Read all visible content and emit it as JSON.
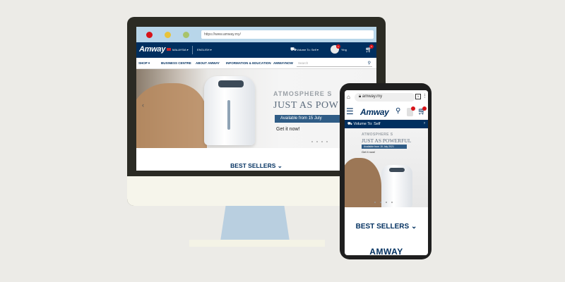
{
  "desktop": {
    "address_url": "https://www.amway.my/",
    "header": {
      "logo": "Amway",
      "country": "MALAYSIA ▾",
      "language": "ENGLISH ▾",
      "volume": "Volume To: Self ▾",
      "user": "Ying",
      "cart_badge": "0",
      "avatar_badge": "1"
    },
    "nav": {
      "items": [
        "SHOP ▾",
        "BUSINESS CENTRE",
        "ABOUT AMWAY",
        "INFORMATION & EDUCATION",
        "AMWAYNOW"
      ],
      "search_placeholder": "Search"
    },
    "hero": {
      "title": "ATMOSPHERE S",
      "subtitle": "JUST AS POW",
      "available": "Available from 15 July",
      "cta": "Get it now!"
    },
    "best_sellers": "BEST SELLERS ⌄"
  },
  "phone": {
    "address_url": "amway.my",
    "tab_count": "1",
    "header": {
      "logo": "Amway"
    },
    "volume": "Volume To: Self",
    "hero": {
      "title": "ATMOSPHERE S",
      "subtitle": "JUST AS POWERFUL",
      "available": "Available from 15 July 2021",
      "cta": "Get it now!"
    },
    "best_sellers": "BEST SELLERS ⌄",
    "footer_logo": "AMWAY"
  },
  "colors": {
    "brand_navy": "#002f5f",
    "browser_bar": "#b8d6ea",
    "background": "#ecebe7",
    "badge_red": "#d7141a"
  },
  "icons": [
    "truck-icon",
    "cart-icon",
    "search-icon",
    "menu-icon",
    "home-icon",
    "lock-icon",
    "kebab-icon",
    "chevron-left-icon",
    "chevron-right-icon"
  ]
}
